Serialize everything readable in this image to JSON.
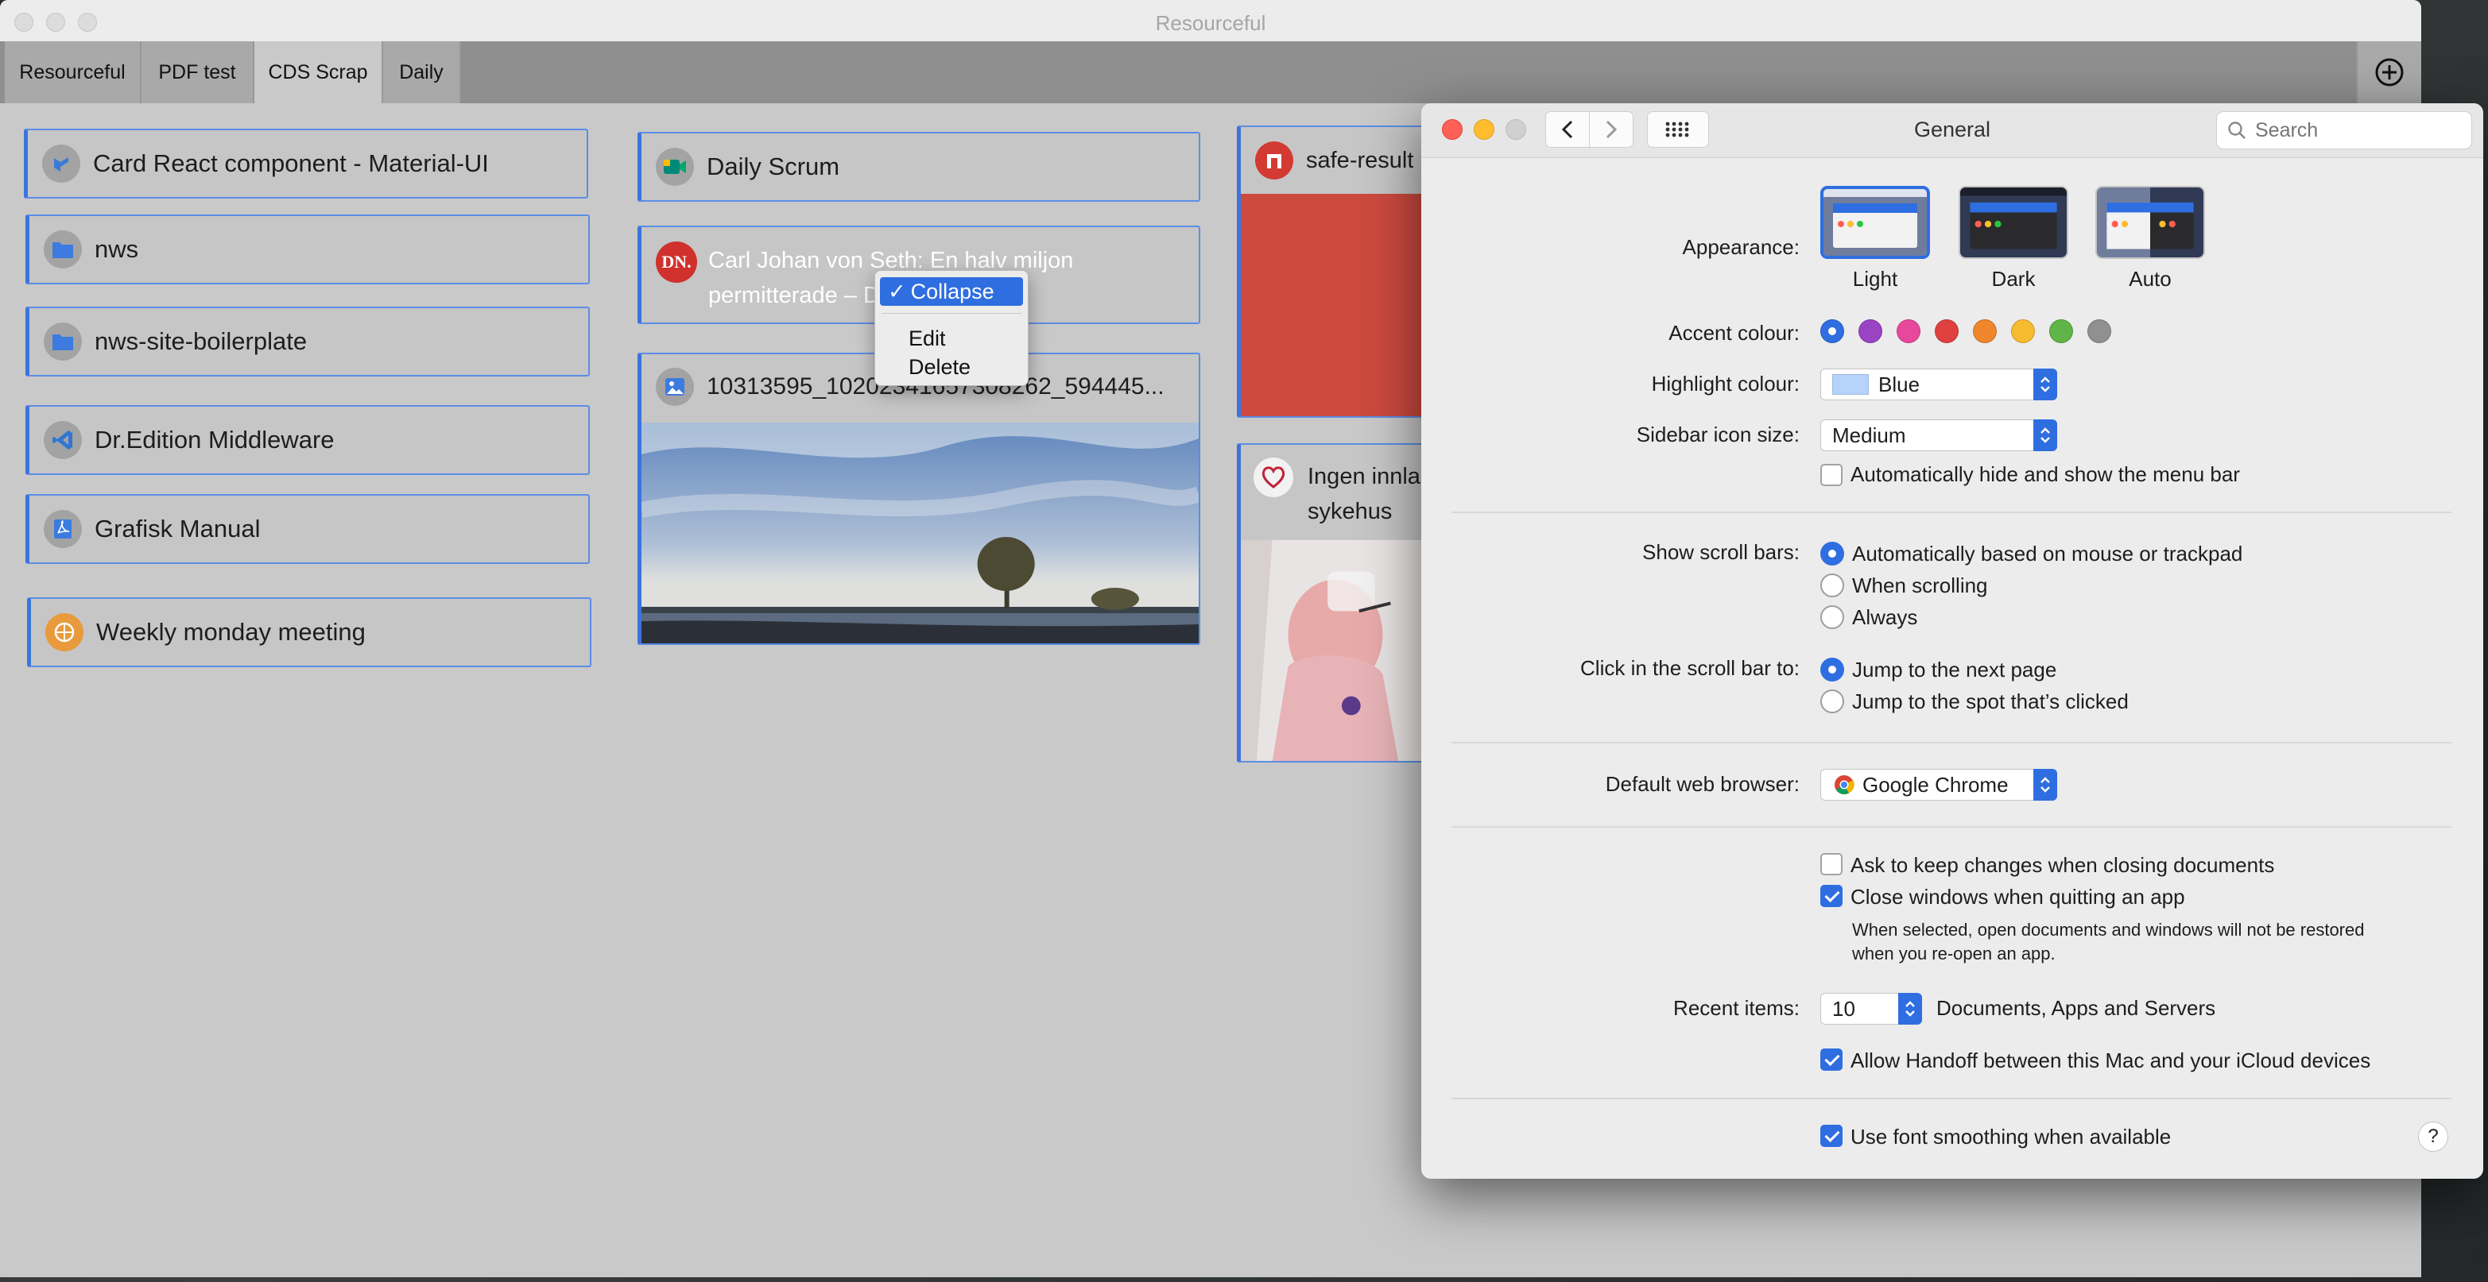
{
  "resourceful": {
    "window_title": "Resourceful",
    "tabs": [
      "Resourceful",
      "PDF test",
      "CDS Scrap",
      "Daily"
    ],
    "active_tab": "CDS Scrap",
    "cards": [
      {
        "title": "Card React component - Material-UI",
        "icon": "material-ui-icon"
      },
      {
        "title": "nws",
        "icon": "folder-icon"
      },
      {
        "title": "nws-site-boilerplate",
        "icon": "folder-icon"
      },
      {
        "title": "Dr.Edition Middleware",
        "icon": "vscode-icon"
      },
      {
        "title": "Grafisk Manual",
        "icon": "pdf-icon"
      },
      {
        "title": "Weekly monday meeting",
        "icon": "meeting-icon"
      },
      {
        "title": "Daily Scrum",
        "icon": "google-meet-icon"
      },
      {
        "title_line1": "Carl Johan von Seth: En halv miljon",
        "title_line2": "permitterade – DN.SE",
        "icon": "dn-logo-icon",
        "icon_text": "DN."
      },
      {
        "title": "10313595_10202341657308262_594445...",
        "icon": "image-icon"
      },
      {
        "title": "safe-result",
        "icon": "safe-logo-icon"
      },
      {
        "title_line1": "Ingen innla",
        "title_line2": "sykehus",
        "icon": "heart-logo-icon"
      }
    ],
    "context_menu": {
      "items": [
        "Collapse",
        "Edit",
        "Delete"
      ],
      "checked": "Collapse",
      "check_mark": "✓"
    }
  },
  "prefs": {
    "title": "General",
    "search_placeholder": "Search",
    "appearance": {
      "label": "Appearance:",
      "options": [
        "Light",
        "Dark",
        "Auto"
      ],
      "selected": "Light"
    },
    "accent": {
      "label": "Accent colour:",
      "colors": [
        "#2f6ee0",
        "#9a44c4",
        "#e7489b",
        "#e04040",
        "#f0862c",
        "#f7bb30",
        "#5fb547",
        "#909090"
      ],
      "selected_index": 0
    },
    "highlight": {
      "label": "Highlight colour:",
      "value": "Blue",
      "swatch": "#b5d3fb"
    },
    "sidebar_icon_size": {
      "label": "Sidebar icon size:",
      "value": "Medium"
    },
    "auto_hide_menu": {
      "label": "Automatically hide and show the menu bar",
      "checked": false
    },
    "scroll_bars": {
      "label": "Show scroll bars:",
      "options": [
        "Automatically based on mouse or trackpad",
        "When scrolling",
        "Always"
      ],
      "selected_index": 0
    },
    "click_scroll": {
      "label": "Click in the scroll bar to:",
      "options": [
        "Jump to the next page",
        "Jump to the spot that’s clicked"
      ],
      "selected_index": 0
    },
    "browser": {
      "label": "Default web browser:",
      "value": "Google Chrome"
    },
    "ask_keep_changes": {
      "label": "Ask to keep changes when closing documents",
      "checked": false
    },
    "close_windows": {
      "label": "Close windows when quitting an app",
      "checked": true
    },
    "close_windows_note_line1": "When selected, open documents and windows will not be restored",
    "close_windows_note_line2": "when you re-open an app.",
    "recent_items": {
      "label": "Recent items:",
      "value": "10",
      "suffix": "Documents, Apps and Servers"
    },
    "handoff": {
      "label": "Allow Handoff between this Mac and your iCloud devices",
      "checked": true
    },
    "font_smoothing": {
      "label": "Use font smoothing when available",
      "checked": true
    },
    "help": "?"
  }
}
